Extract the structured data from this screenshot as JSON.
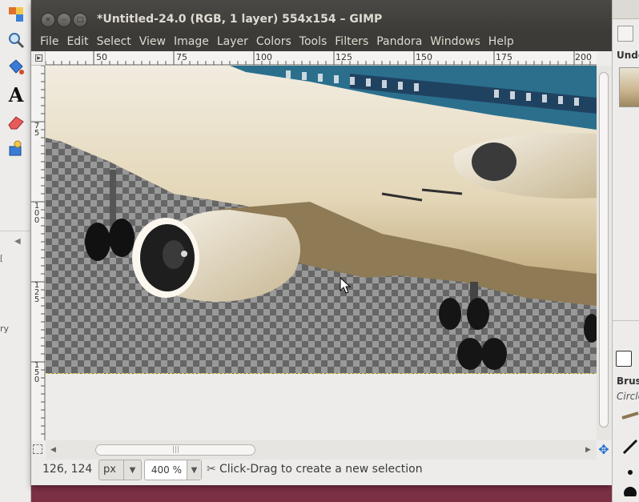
{
  "window": {
    "title": "*Untitled-24.0 (RGB, 1 layer) 554x154 – GIMP",
    "close_glyph": "×",
    "minimize_glyph": "–",
    "maximize_glyph": "□"
  },
  "menubar": {
    "items": [
      "File",
      "Edit",
      "Select",
      "View",
      "Image",
      "Layer",
      "Colors",
      "Tools",
      "Filters",
      "Pandora",
      "Windows",
      "Help"
    ]
  },
  "ruler": {
    "horizontal_labels": [
      "50",
      "75",
      "100",
      "125",
      "150",
      "175",
      "200"
    ],
    "vertical_labels": [
      "75",
      "100",
      "125",
      "150"
    ]
  },
  "toolbox": {
    "tools": [
      "select-tool-icon",
      "zoom-tool-icon",
      "bucket-fill-icon",
      "text-tool-icon",
      "eraser-icon",
      "clone-tool-icon"
    ],
    "text_tool_glyph": "A",
    "fragment_1": "[",
    "fragment_2": "ry"
  },
  "dock": {
    "undo_label": "Undo",
    "brushes_label": "Brus",
    "brush_name": "Circle"
  },
  "statusbar": {
    "coords": "126, 124",
    "unit": "px",
    "zoom": "400 %",
    "message": "Click-Drag to create a new selection"
  },
  "scrollbars": {
    "grip": "|||"
  },
  "colors": {
    "titlebar": "#3c3b37",
    "menu_text": "#dfdbd2",
    "checker_dark": "#666666",
    "checker_light": "#999999",
    "selection_border": "#e5d34a",
    "plane_body": "#e6dcc2",
    "plane_stripe": "#2a6f8a"
  }
}
